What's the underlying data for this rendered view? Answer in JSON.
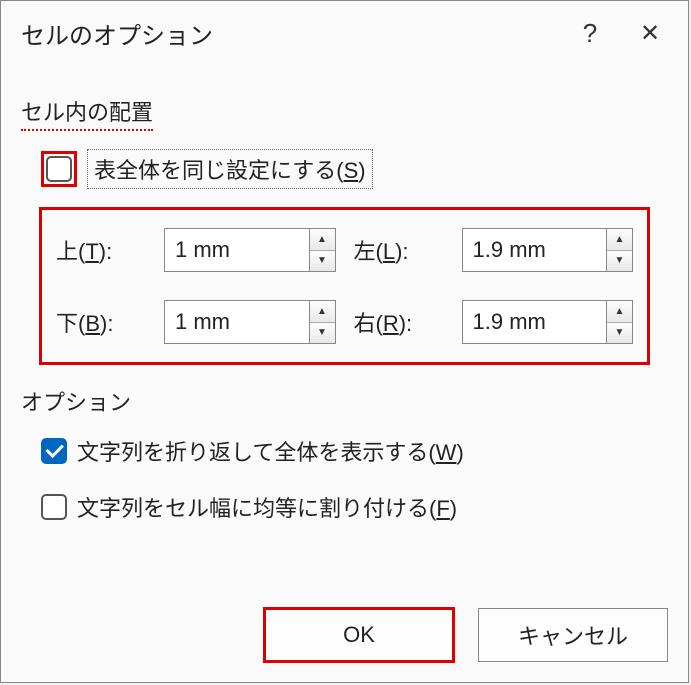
{
  "titlebar": {
    "title": "セルのオプション",
    "help_icon": "?",
    "close_icon": "✕"
  },
  "sections": {
    "cell_margins_header": "セル内の配置",
    "options_header": "オプション"
  },
  "same_as_table": {
    "label_prefix": "表全体を同じ設定にする(",
    "mnemonic": "S",
    "label_suffix": ")",
    "checked": false
  },
  "margins": {
    "top": {
      "label_prefix": "上(",
      "mnemonic": "T",
      "label_suffix": "):",
      "value": "1 mm"
    },
    "bottom": {
      "label_prefix": "下(",
      "mnemonic": "B",
      "label_suffix": "):",
      "value": "1 mm"
    },
    "left": {
      "label_prefix": "左(",
      "mnemonic": "L",
      "label_suffix": "):",
      "value": "1.9 mm"
    },
    "right": {
      "label_prefix": "右(",
      "mnemonic": "R",
      "label_suffix": "):",
      "value": "1.9 mm"
    }
  },
  "options": {
    "wrap_text": {
      "label_prefix": "文字列を折り返して全体を表示する(",
      "mnemonic": "W",
      "label_suffix": ")",
      "checked": true
    },
    "fit_text": {
      "label_prefix": "文字列をセル幅に均等に割り付ける(",
      "mnemonic": "F",
      "label_suffix": ")",
      "checked": false
    }
  },
  "buttons": {
    "ok": "OK",
    "cancel": "キャンセル"
  },
  "colors": {
    "highlight": "#d00",
    "accent": "#0067c0"
  }
}
